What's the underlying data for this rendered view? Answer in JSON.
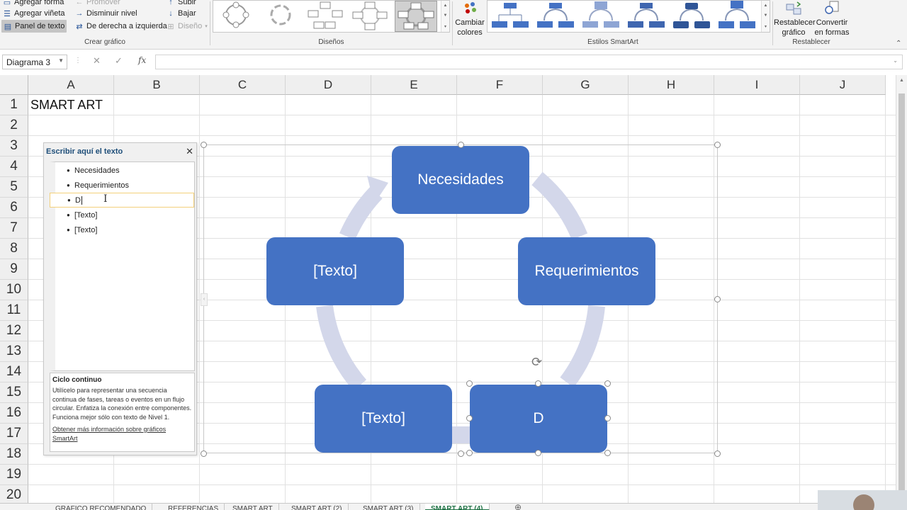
{
  "ribbon": {
    "crear_grafico": {
      "add_shape": "Agregar forma",
      "promote": "Promover",
      "move_up": "Subir",
      "add_bullet": "Agregar viñeta",
      "demote": "Disminuir nivel",
      "move_down": "Bajar",
      "text_pane": "Panel de texto",
      "rtl": "De derecha a izquierda",
      "layout": "Diseño",
      "label": "Crear gráfico"
    },
    "disenos": {
      "label": "Diseños"
    },
    "cambiar_colores": "Cambiar colores",
    "estilos": {
      "label": "Estilos SmartArt"
    },
    "restablecer": {
      "reset_graphic": "Restablecer gráfico",
      "convert_shapes": "Convertir en formas",
      "label": "Restablecer"
    }
  },
  "formula_bar": {
    "name_box": "Diagrama 3",
    "cancel_icon": "✕",
    "enter_icon": "✓",
    "fx": "fx",
    "value": ""
  },
  "grid": {
    "columns": [
      "A",
      "B",
      "C",
      "D",
      "E",
      "F",
      "G",
      "H",
      "I",
      "J"
    ],
    "rows": [
      "1",
      "2",
      "3",
      "4",
      "5",
      "6",
      "7",
      "8",
      "9",
      "10",
      "11",
      "12",
      "13",
      "14",
      "15",
      "16",
      "17",
      "18",
      "19",
      "20"
    ],
    "a1": "SMART ART"
  },
  "text_pane": {
    "title": "Escribir aquí el texto",
    "close": "✕",
    "items": [
      "Necesidades",
      "Requerimientos",
      "D",
      "[Texto]",
      "[Texto]"
    ],
    "info_title": "Ciclo continuo",
    "info_desc": "Utilícelo para representar una secuencia continua de fases, tareas o eventos en un flujo circular. Enfatiza la conexión entre componentes. Funciona mejor sólo con texto de Nivel 1.",
    "info_link": "Obtener más información sobre gráficos SmartArt"
  },
  "smartart": {
    "nodes": [
      "Necesidades",
      "Requerimientos",
      "D",
      "[Texto]",
      "[Texto]"
    ],
    "node_color": "#4472c4",
    "arrow_color": "#d3d7ea"
  },
  "sheets": {
    "tabs": [
      "GRAFICO RECOMENDADO",
      "REFERENCIAS",
      "SMART ART",
      "SMART ART (2)",
      "SMART ART (3)",
      "SMART ART (4)"
    ],
    "active": "SMART ART (4)"
  }
}
